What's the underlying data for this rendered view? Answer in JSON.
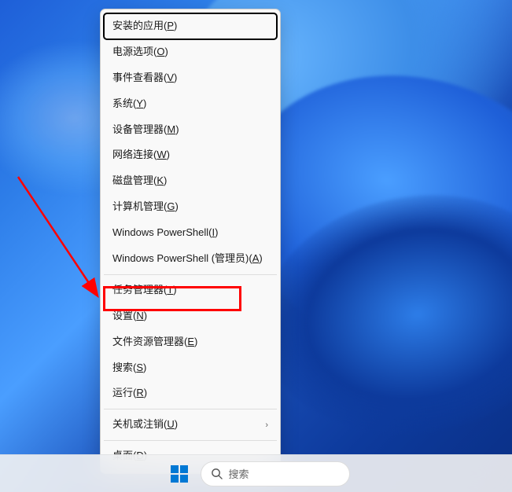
{
  "context_menu": {
    "items": [
      {
        "label": "安装的应用",
        "accelerator": "P",
        "submenu": false
      },
      {
        "label": "电源选项",
        "accelerator": "O",
        "submenu": false
      },
      {
        "label": "事件查看器",
        "accelerator": "V",
        "submenu": false
      },
      {
        "label": "系统",
        "accelerator": "Y",
        "submenu": false
      },
      {
        "label": "设备管理器",
        "accelerator": "M",
        "submenu": false
      },
      {
        "label": "网络连接",
        "accelerator": "W",
        "submenu": false
      },
      {
        "label": "磁盘管理",
        "accelerator": "K",
        "submenu": false
      },
      {
        "label": "计算机管理",
        "accelerator": "G",
        "submenu": false
      },
      {
        "label": "Windows PowerShell",
        "accelerator": "I",
        "submenu": false
      },
      {
        "label": "Windows PowerShell (管理员)",
        "accelerator": "A",
        "submenu": false
      },
      {
        "label": "任务管理器",
        "accelerator": "T",
        "submenu": false
      },
      {
        "label": "设置",
        "accelerator": "N",
        "submenu": false
      },
      {
        "label": "文件资源管理器",
        "accelerator": "E",
        "submenu": false
      },
      {
        "label": "搜索",
        "accelerator": "S",
        "submenu": false
      },
      {
        "label": "运行",
        "accelerator": "R",
        "submenu": false
      },
      {
        "label": "关机或注销",
        "accelerator": "U",
        "submenu": true
      },
      {
        "label": "桌面",
        "accelerator": "D",
        "submenu": false
      }
    ],
    "highlighted_index": 0,
    "red_boxed_index": 11,
    "dividers_after": [
      9,
      14,
      15
    ]
  },
  "taskbar": {
    "search_placeholder": "搜索"
  },
  "annotations": {
    "arrow_color": "#ff0000",
    "box_color": "#ff0000"
  }
}
